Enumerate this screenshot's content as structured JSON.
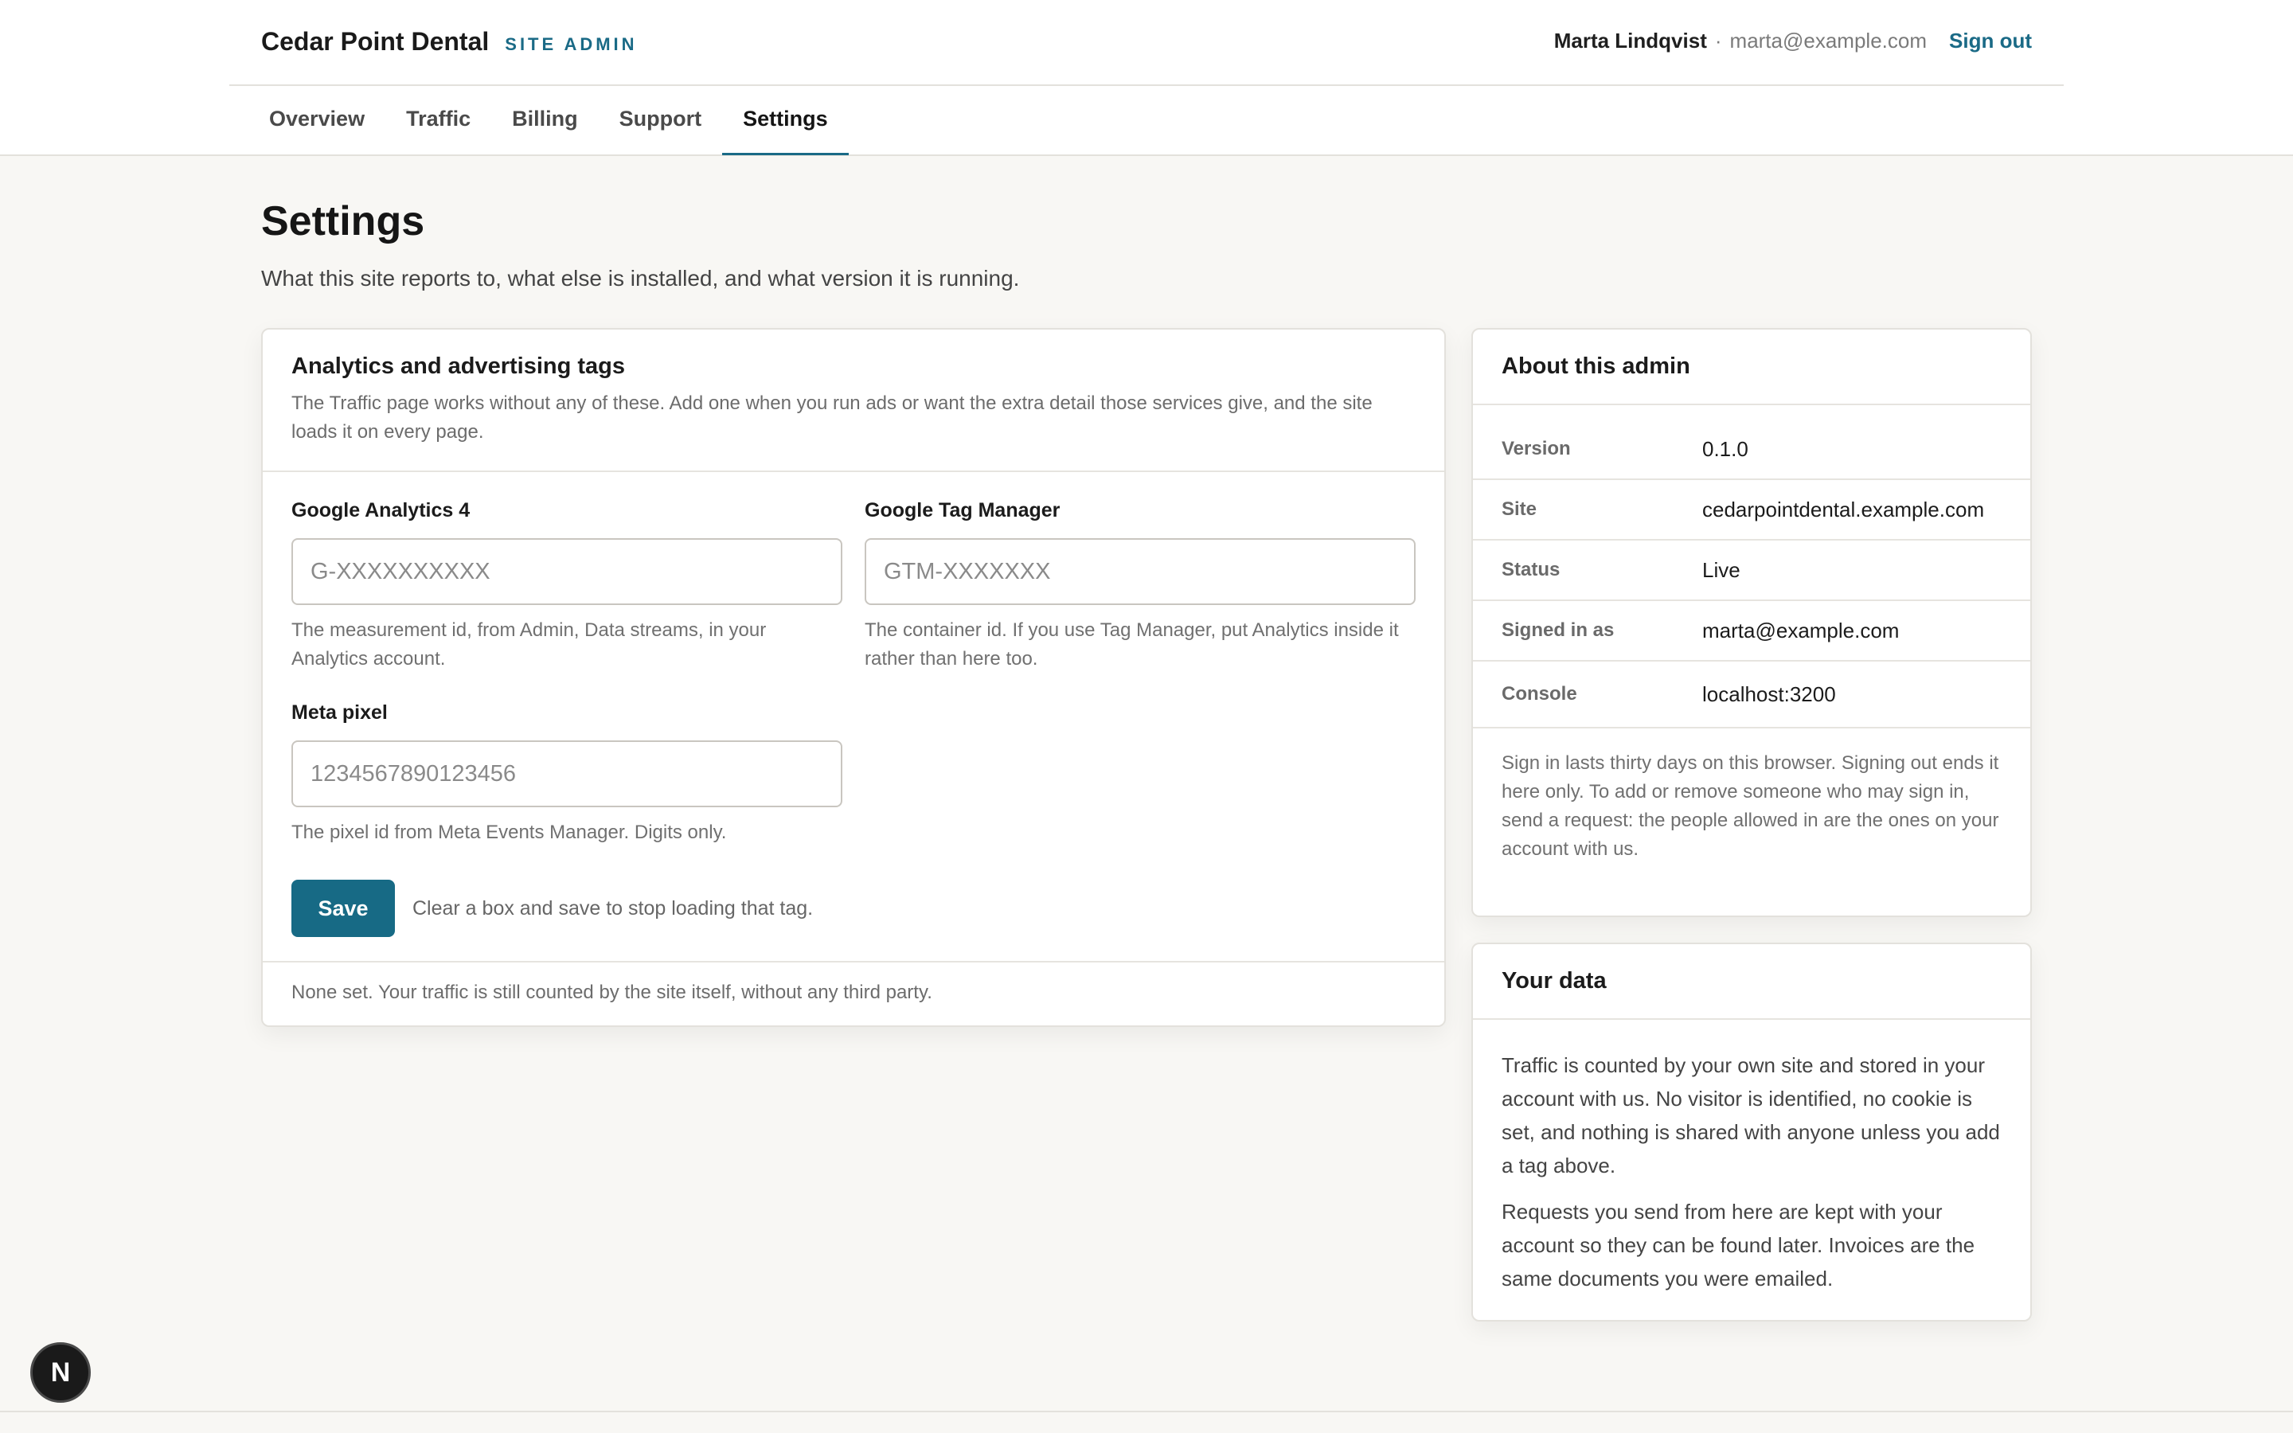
{
  "header": {
    "brand_name": "Cedar Point Dental",
    "brand_tag": "SITE ADMIN",
    "user_name": "Marta Lindqvist",
    "user_sep": "·",
    "user_email": "marta@example.com",
    "signout_label": "Sign out"
  },
  "tabs": [
    {
      "label": "Overview"
    },
    {
      "label": "Traffic"
    },
    {
      "label": "Billing"
    },
    {
      "label": "Support"
    },
    {
      "label": "Settings",
      "active": true
    }
  ],
  "page": {
    "title": "Settings",
    "subtitle": "What this site reports to, what else is installed, and what version it is running."
  },
  "tags_card": {
    "title": "Analytics and advertising tags",
    "description": "The Traffic page works without any of these. Add one when you run ads or want the extra detail those services give, and the site loads it on every page.",
    "fields": {
      "ga4": {
        "label": "Google Analytics 4",
        "value": "",
        "placeholder": "G-XXXXXXXXXX",
        "help": "The measurement id, from Admin, Data streams, in your Analytics account."
      },
      "gtm": {
        "label": "Google Tag Manager",
        "value": "",
        "placeholder": "GTM-XXXXXXX",
        "help": "The container id. If you use Tag Manager, put Analytics inside it rather than here too."
      },
      "meta": {
        "label": "Meta pixel",
        "value": "",
        "placeholder": "1234567890123456",
        "help": "The pixel id from Meta Events Manager. Digits only."
      }
    },
    "save_label": "Save",
    "save_hint": "Clear a box and save to stop loading that tag.",
    "footer": "None set. Your traffic is still counted by the site itself, without any third party."
  },
  "about_card": {
    "title": "About this admin",
    "rows": [
      {
        "key": "Version",
        "value": "0.1.0"
      },
      {
        "key": "Site",
        "value": "cedarpointdental.example.com"
      },
      {
        "key": "Status",
        "value": "Live"
      },
      {
        "key": "Signed in as",
        "value": "marta@example.com"
      },
      {
        "key": "Console",
        "value": "localhost:3200"
      }
    ],
    "note": "Sign in lasts thirty days on this browser. Signing out ends it here only. To add or remove someone who may sign in, send a request: the people allowed in are the ones on your account with us."
  },
  "data_card": {
    "title": "Your data",
    "paragraphs": [
      "Traffic is counted by your own site and stored in your account with us. No visitor is identified, no cookie is set, and nothing is shared with anyone unless you add a tag above.",
      "Requests you send from here are kept with your account so they can be found later. Invoices are the same documents you were emailed."
    ]
  },
  "dev_badge": {
    "label": "N",
    "icon": "nextjs-icon"
  },
  "colors": {
    "accent": "#176a85",
    "background": "#f8f7f4"
  }
}
